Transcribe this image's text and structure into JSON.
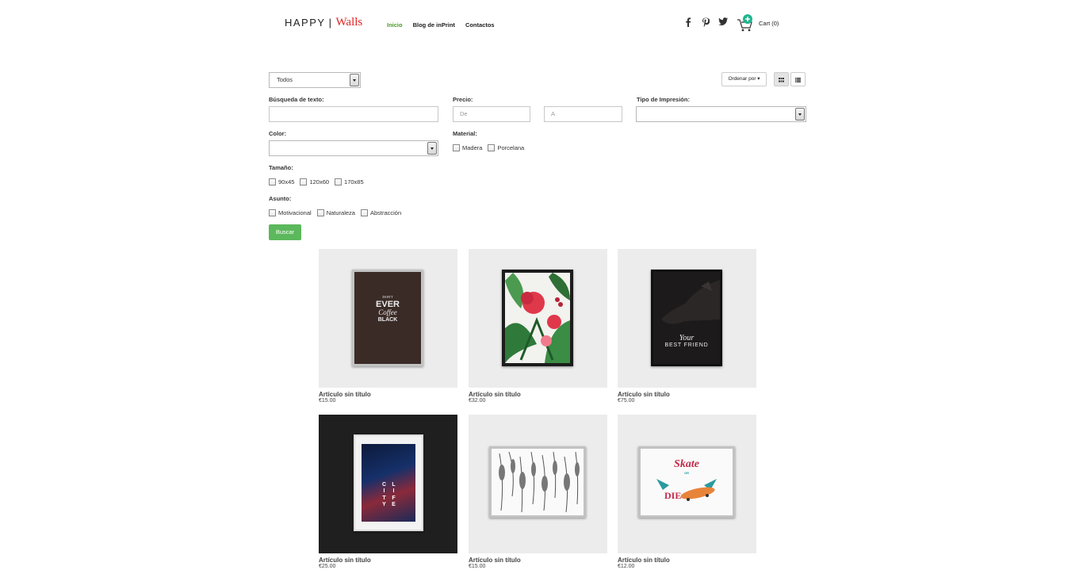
{
  "header": {
    "logo_left": "HAPPY",
    "logo_sep": "|",
    "logo_right": "Walls",
    "nav": [
      {
        "label": "Inicio",
        "active": true
      },
      {
        "label": "Blog de inPrint",
        "active": false
      },
      {
        "label": "Contactos",
        "active": false
      }
    ],
    "social": [
      "facebook-icon",
      "pinterest-icon",
      "twitter-icon"
    ],
    "cart_label": "Cart (0)"
  },
  "filters": {
    "category_select": "Todos",
    "text_search_label": "Búsqueda de texto:",
    "price_label": "Precio:",
    "price_from_placeholder": "De",
    "price_to_placeholder": "A",
    "print_type_label": "Tipo de Impresión:",
    "color_label": "Color:",
    "material_label": "Material:",
    "materials": [
      "Madera",
      "Porcelana"
    ],
    "size_label": "Tamaño:",
    "sizes": [
      "90x45",
      "120x60",
      "170x85"
    ],
    "subject_label": "Asunto:",
    "subjects": [
      "Motivacional",
      "Naturaleza",
      "Abstracción"
    ],
    "search_button": "Buscar",
    "sort_label": "Ordenar por ▾"
  },
  "products": [
    {
      "title": "Artículo sin título",
      "price": "€15.00",
      "art": "coffee"
    },
    {
      "title": "Artículo sin título",
      "price": "€32.00",
      "art": "floral"
    },
    {
      "title": "Artículo sin título",
      "price": "€75.00",
      "art": "dog"
    },
    {
      "title": "Artículo sin título",
      "price": "€25.00",
      "art": "city"
    },
    {
      "title": "Artículo sin título",
      "price": "€15.00",
      "art": "feathers"
    },
    {
      "title": "Artículo sin título",
      "price": "€12.00",
      "art": "skate"
    }
  ],
  "art_text": {
    "coffee": [
      "DON'T",
      "EVER",
      "Coffee",
      "BLACK"
    ],
    "dog": [
      "Your",
      "BEST FRIEND"
    ],
    "city_left": "CITY",
    "city_right": "LIFE",
    "skate_top": "Skate",
    "skate_mid": "OR",
    "skate_bottom": "DIE"
  },
  "colors": {
    "accent_green": "#5cb85c",
    "nav_active": "#4a9a2a",
    "logo_red": "#e02424",
    "cart_badge": "#1fb58f"
  }
}
